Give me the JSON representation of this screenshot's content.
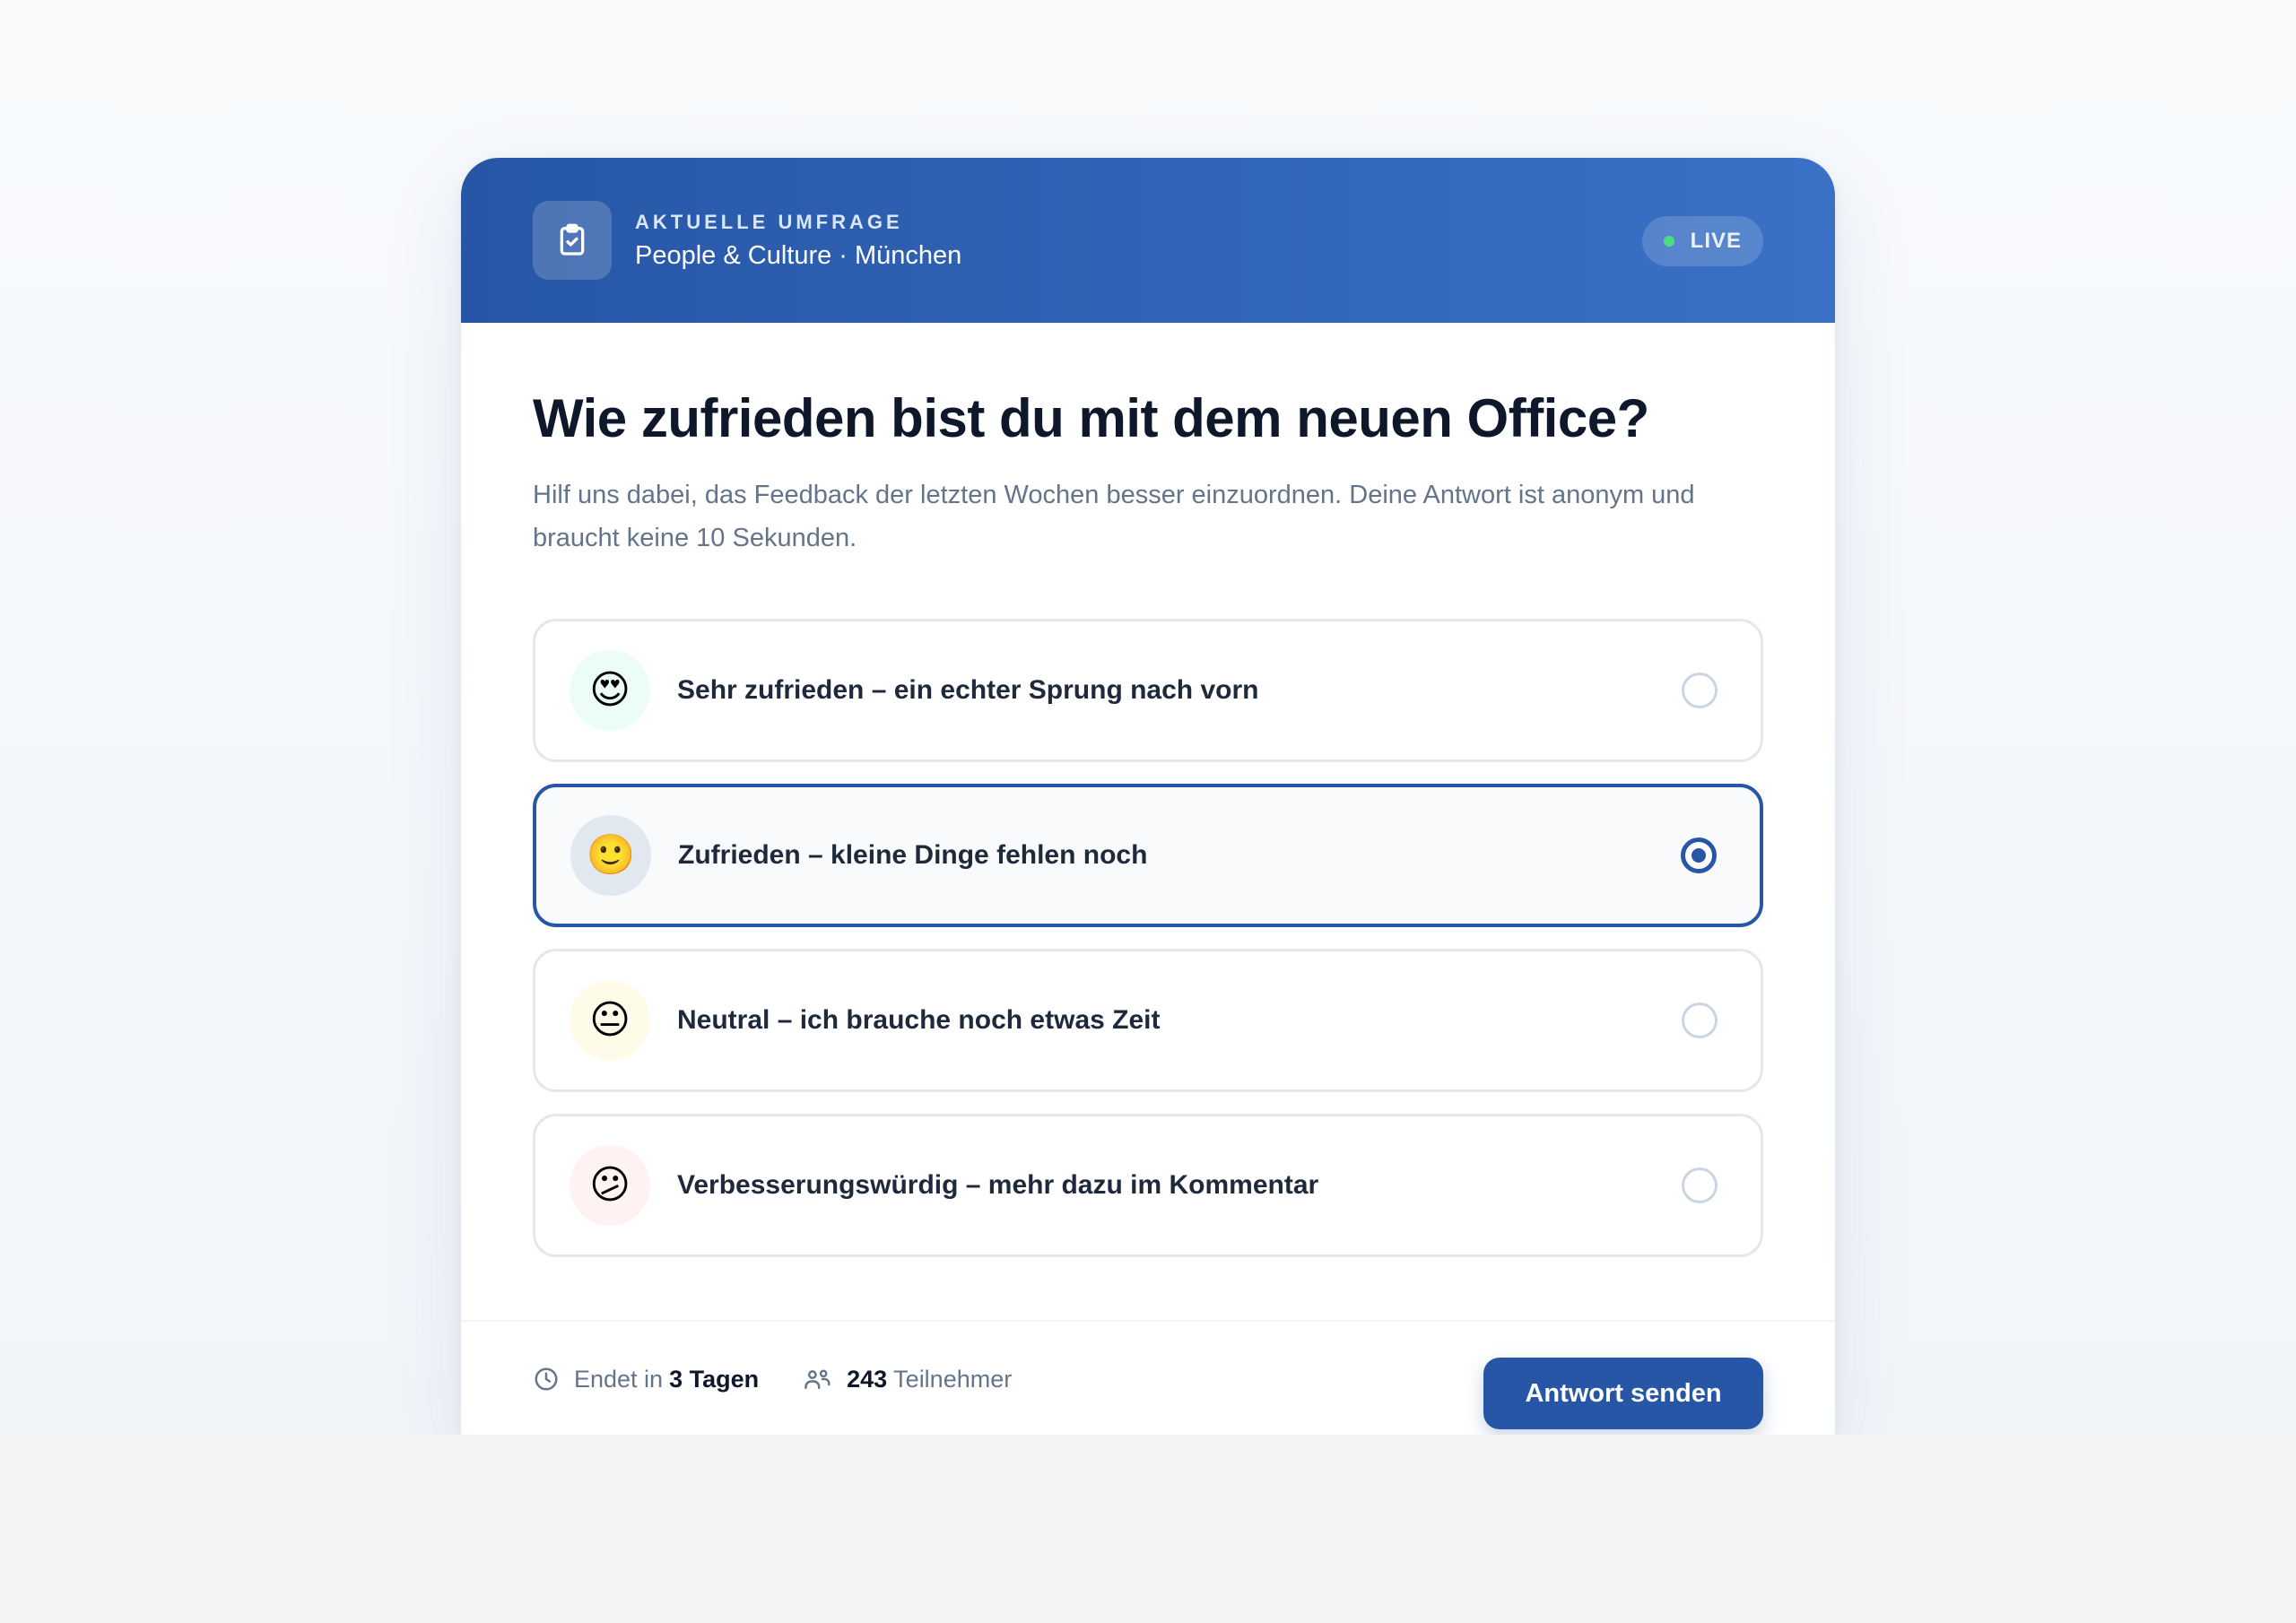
{
  "header": {
    "eyebrow": "AKTUELLE UMFRAGE",
    "subtitle": "People & Culture · München",
    "badge": "LIVE",
    "icon": "clipboard-check-icon"
  },
  "question": {
    "title": "Wie zufrieden bist du mit dem neuen Office?",
    "description": "Hilf uns dabei, das Feedback der letzten Wochen besser einzuordnen. Deine Antwort ist anonym und braucht keine 10 Sekunden."
  },
  "options": [
    {
      "emoji": "😍",
      "label": "Sehr zufrieden – ein echter Sprung nach vorn",
      "selected": false,
      "tint": "#ecfdf5"
    },
    {
      "emoji": "🙂",
      "label": "Zufrieden – kleine Dinge fehlen noch",
      "selected": true,
      "tint": "#e2e8f0"
    },
    {
      "emoji": "😐",
      "label": "Neutral – ich brauche noch etwas Zeit",
      "selected": false,
      "tint": "#fefce8"
    },
    {
      "emoji": "😕",
      "label": "Verbesserungswürdig – mehr dazu im Kommentar",
      "selected": false,
      "tint": "#fef2f2"
    }
  ],
  "footer": {
    "ends_prefix": "Endet in",
    "ends_value": "3 Tagen",
    "participants_count": "243",
    "participants_label": "Teilnehmer",
    "submit_label": "Antwort senden"
  },
  "colors": {
    "primary": "#2756a6",
    "live_dot": "#4ade80"
  }
}
